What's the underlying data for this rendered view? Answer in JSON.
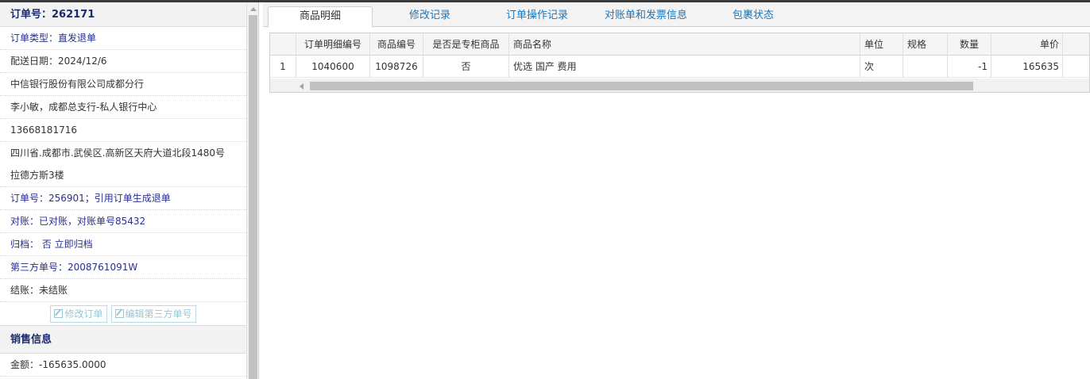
{
  "order": {
    "header": "订单号：262171",
    "type": "订单类型：直发退单",
    "delivery_date": "配送日期：2024/12/6",
    "company": "中信银行股份有限公司成都分行",
    "contact": "李小敏，成都总支行-私人银行中心",
    "phone": "13668181716",
    "address": "四川省.成都市.武侯区.高新区天府大道北段1480号拉德方斯3楼",
    "ref_order": "订单号：256901；引用订单生成退单",
    "reconcile": "对账：已对账，对账单号85432",
    "archive": "归档：  否 立即归档",
    "third_party": "第三方单号：2008761091W",
    "settlement": "结账：未结账",
    "buttons": {
      "edit_order": "修改订单",
      "edit_third_party": "编辑第三方单号"
    }
  },
  "sales": {
    "header": "销售信息",
    "amount": "金额：-165635.0000"
  },
  "tabs": [
    {
      "label": "商品明细"
    },
    {
      "label": "修改记录"
    },
    {
      "label": "订单操作记录"
    },
    {
      "label": "对账单和发票信息"
    },
    {
      "label": "包裹状态"
    }
  ],
  "grid": {
    "columns": [
      "",
      "订单明细编号",
      "商品编号",
      "是否是专柜商品",
      "商品名称",
      "单位",
      "规格",
      "数量",
      "单价"
    ],
    "rows": [
      [
        "1",
        "1040600",
        "1098726",
        "否",
        "优选 国产 费用",
        "次",
        "",
        "-1",
        "165635"
      ]
    ]
  }
}
